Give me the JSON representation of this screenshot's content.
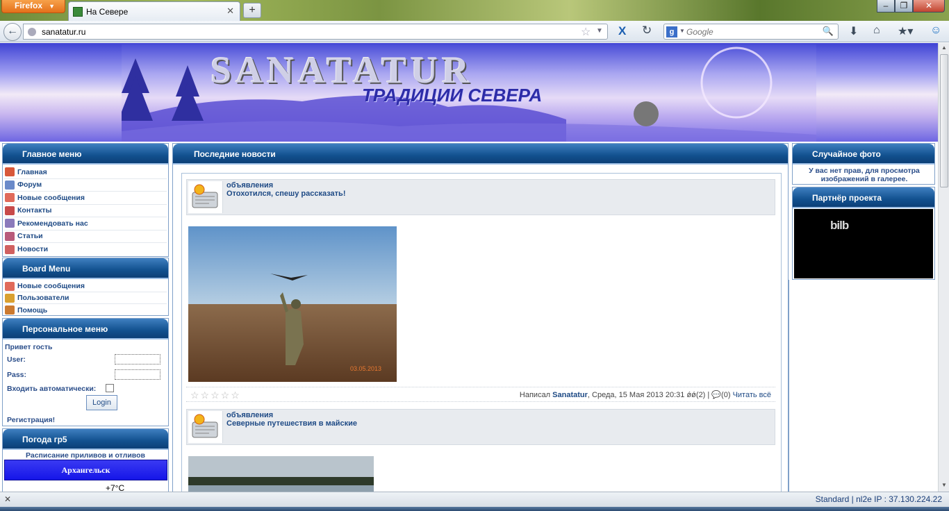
{
  "browser": {
    "app_button": "Firefox",
    "tab_title": "На Севере",
    "url": "sanatatur.ru",
    "search_engine": "Google",
    "search_placeholder": "Google",
    "status_right": "Standard | nl2e    IP : 37.130.224.22"
  },
  "banner": {
    "brand": "SANATATUR",
    "slogan": "ТРАДИЦИИ СЕВЕРА"
  },
  "main_menu": {
    "title": "Главное меню",
    "items": [
      {
        "label": "Главная",
        "icon": "home-icon"
      },
      {
        "label": "Форум",
        "icon": "forum-icon"
      },
      {
        "label": "Новые сообщения",
        "icon": "new-posts-icon"
      },
      {
        "label": "Контакты",
        "icon": "contacts-icon"
      },
      {
        "label": "Рекомендовать нас",
        "icon": "recommend-icon"
      },
      {
        "label": "Статьи",
        "icon": "articles-icon"
      },
      {
        "label": "Новости",
        "icon": "news-icon"
      }
    ]
  },
  "board_menu": {
    "title": "Board Menu",
    "items": [
      {
        "label": "Новые сообщения",
        "icon": "new-posts-icon"
      },
      {
        "label": "Пользователи",
        "icon": "users-icon"
      },
      {
        "label": "Помощь",
        "icon": "help-icon"
      }
    ]
  },
  "personal_menu": {
    "title": "Персональное меню",
    "greeting": "Привет гость",
    "user_label": "User:",
    "pass_label": "Pass:",
    "autologin_label": "Входить автоматически:",
    "login_button": "Login",
    "register_link": "Регистрация!"
  },
  "weather": {
    "title": "Погода гр5",
    "tides_link": "Расписание приливов и отливов",
    "city": "Архангельск",
    "temp": "+7°C"
  },
  "news": {
    "title": "Последние новости",
    "items": [
      {
        "category": "объявления",
        "title": "Отохотился, спешу рассказать!",
        "photo_date": "03.05.2013",
        "rating": 0,
        "meta_prefix": "Написал",
        "author": "Sanatatur",
        "date": ", Среда, 15 Мая 2013 20:31",
        "views": "(2)",
        "comments": "(0)",
        "read_more": "Читать всё"
      },
      {
        "category": "объявления",
        "title": "Северные путешествия в майские"
      }
    ]
  },
  "random_photo": {
    "title": "Случайное фото",
    "text": "У вас нет прав, для просмотра изображений в галерее."
  },
  "partner": {
    "title": "Партнёр проекта",
    "logo_text": "bilb"
  },
  "colors": {
    "header_blue": "#12518f",
    "link_blue": "#1e4a85",
    "weather_bar": "#1515e8"
  }
}
